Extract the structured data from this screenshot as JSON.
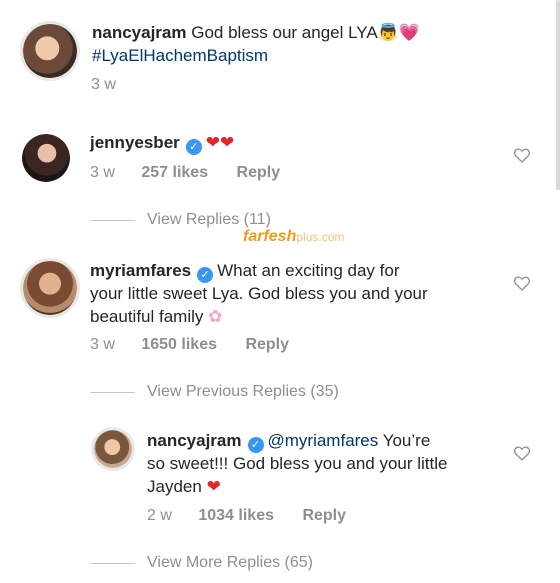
{
  "post_caption": {
    "username": "nancyajram",
    "text": "God bless our angel LYA",
    "emoji_angel": "👼",
    "emoji_heart": "💗",
    "hashtag": "#LyaElHachemBaptism",
    "time": "3 w"
  },
  "comments": [
    {
      "username": "jennyesber",
      "verified_glyph": "✓",
      "text": "❤❤",
      "time": "3 w",
      "likes": "257 likes",
      "reply_label": "Reply",
      "view_replies": "View Replies (11)"
    },
    {
      "username": "myriamfares",
      "verified_glyph": "✓",
      "line1": "What an exciting day for",
      "line2": "your little sweet Lya. God bless you and your",
      "line3": "beautiful family",
      "emoji_flower": "✿",
      "time": "3 w",
      "likes": "1650 likes",
      "reply_label": "Reply",
      "view_previous": "View Previous Replies (35)"
    },
    {
      "username": "nancyajram",
      "verified_glyph": "✓",
      "mention": "@myriamfares",
      "line1": "You’re",
      "line2": "so sweet!!! God bless you and your little",
      "line3": "Jayden",
      "emoji_heart": "❤",
      "time": "2 w",
      "likes": "1034 likes",
      "reply_label": "Reply",
      "view_more": "View More Replies (65)"
    }
  ],
  "watermark": {
    "brand": "farfesh",
    "suffix": "plus.com"
  },
  "colors": {
    "text": "#262626",
    "meta": "#8e8e8e",
    "hashtag": "#00376b",
    "verified": "#3897f0",
    "heart": "#e3242b"
  }
}
